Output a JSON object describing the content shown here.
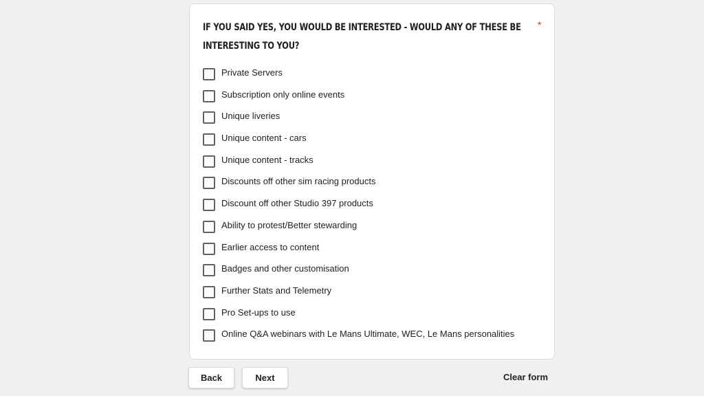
{
  "question": {
    "title": "If you said yes, you would be interested -  would any of these be interesting to you?",
    "required_marker": "*",
    "options": [
      "Private Servers",
      "Subscription only online events",
      "Unique liveries",
      "Unique content - cars",
      "Unique content - tracks",
      "Discounts off other sim racing products",
      "Discount off other Studio 397 products",
      "Ability to protest/Better stewarding",
      "Earlier access to content",
      "Badges and other customisation",
      "Further Stats and Telemetry",
      "Pro Set-ups to use",
      "Online Q&A webinars with Le Mans Ultimate, WEC, Le Mans personalities"
    ]
  },
  "navigation": {
    "back_label": "Back",
    "next_label": "Next",
    "clear_label": "Clear form"
  },
  "colors": {
    "page_background": "#f0f0f0",
    "card_background": "#ffffff",
    "required_star": "#d93025",
    "checkbox_border": "#5f6368"
  }
}
